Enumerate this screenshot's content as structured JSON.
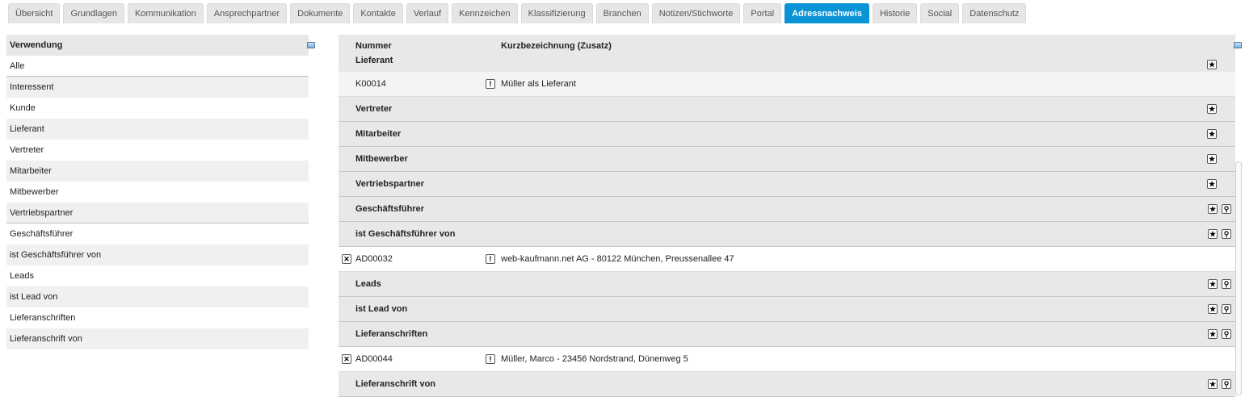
{
  "tabs": [
    {
      "label": "Übersicht"
    },
    {
      "label": "Grundlagen"
    },
    {
      "label": "Kommunikation"
    },
    {
      "label": "Ansprechpartner"
    },
    {
      "label": "Dokumente"
    },
    {
      "label": "Kontakte"
    },
    {
      "label": "Verlauf"
    },
    {
      "label": "Kennzeichen"
    },
    {
      "label": "Klassifizierung"
    },
    {
      "label": "Branchen"
    },
    {
      "label": "Notizen/Stichworte"
    },
    {
      "label": "Portal"
    },
    {
      "label": "Adressnachweis",
      "active": true
    },
    {
      "label": "Historie"
    },
    {
      "label": "Social"
    },
    {
      "label": "Datenschutz"
    }
  ],
  "left": {
    "header": "Verwendung",
    "items": [
      "Alle",
      "Interessent",
      "Kunde",
      "Lieferant",
      "Vertreter",
      "Mitarbeiter",
      "Mitbewerber",
      "Vertriebspartner",
      "Geschäftsführer",
      "ist Geschäftsführer von",
      "Leads",
      "ist Lead von",
      "Lieferanschriften",
      "Lieferanschrift von"
    ]
  },
  "right": {
    "col_number": "Nummer",
    "col_desc": "Kurzbezeichnung (Zusatz)",
    "first_group": "Lieferant",
    "rows": [
      {
        "type": "data",
        "number": "K00014",
        "desc": "Müller als Lieferant"
      },
      {
        "type": "group",
        "label": "Vertreter"
      },
      {
        "type": "group",
        "label": "Mitarbeiter"
      },
      {
        "type": "group",
        "label": "Mitbewerber"
      },
      {
        "type": "group",
        "label": "Vertriebspartner"
      },
      {
        "type": "group",
        "label": "Geschäftsführer"
      },
      {
        "type": "group",
        "label": "ist Geschäftsführer von"
      },
      {
        "type": "data",
        "number": "AD00032",
        "desc": "web-kaufmann.net AG - 80122 München, Preussenallee 47"
      },
      {
        "type": "group",
        "label": "Leads"
      },
      {
        "type": "group",
        "label": "ist Lead von"
      },
      {
        "type": "group",
        "label": "Lieferanschriften"
      },
      {
        "type": "data",
        "number": "AD00044",
        "desc": "Müller, Marco - 23456 Nordstrand, Dünenweg 5"
      },
      {
        "type": "group",
        "label": "Lieferanschrift von"
      }
    ],
    "icons": {
      "star": "★",
      "search": "⚲",
      "warn": "!",
      "delete": "✕"
    }
  },
  "colors": {
    "accent": "#0a94d6"
  }
}
